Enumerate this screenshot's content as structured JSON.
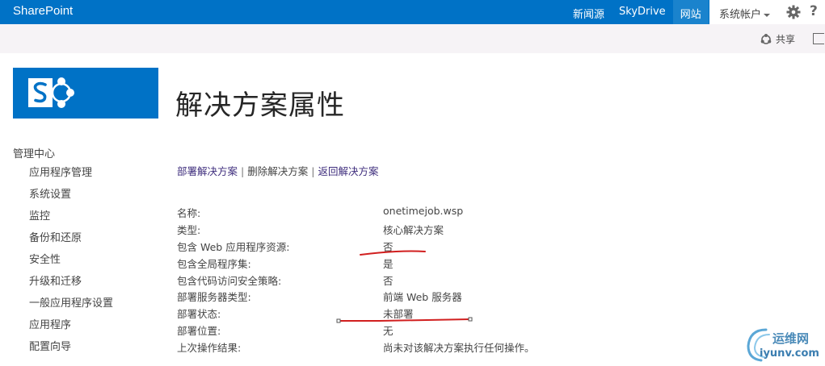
{
  "suitebar": {
    "brand": "SharePoint",
    "links": [
      "新闻源",
      "SkyDrive",
      "网站"
    ],
    "account": "系统帐户",
    "help": "?"
  },
  "ribbon": {
    "share_label": "共享"
  },
  "page_title": "解决方案属性",
  "nav": {
    "header": "管理中心",
    "items": [
      "应用程序管理",
      "系统设置",
      "监控",
      "备份和还原",
      "安全性",
      "升级和迁移",
      "一般应用程序设置",
      "应用程序",
      "配置向导"
    ]
  },
  "actions": {
    "deploy": "部署解决方案",
    "separator": "|",
    "remove": "删除解决方案",
    "back": "返回解决方案"
  },
  "properties": [
    {
      "label": "名称:",
      "value": "onetimejob.wsp"
    },
    {
      "label": "类型:",
      "value": "核心解决方案"
    },
    {
      "label": "包含 Web 应用程序资源:",
      "value": "否"
    },
    {
      "label": "包含全局程序集:",
      "value": "是"
    },
    {
      "label": "包含代码访问安全策略:",
      "value": "否"
    },
    {
      "label": "部署服务器类型:",
      "value": "前端 Web 服务器"
    },
    {
      "label": "部署状态:",
      "value": "未部署"
    },
    {
      "label": "部署位置:",
      "value": "无"
    },
    {
      "label": "上次操作结果:",
      "value": "尚未对该解决方案执行任何操作。"
    }
  ],
  "watermark": {
    "title": "运维网",
    "url": "iyunv.com"
  },
  "colors": {
    "suitebar": "#0072c6",
    "link": "#3f2e7d",
    "annotation": "#d11f1f"
  }
}
